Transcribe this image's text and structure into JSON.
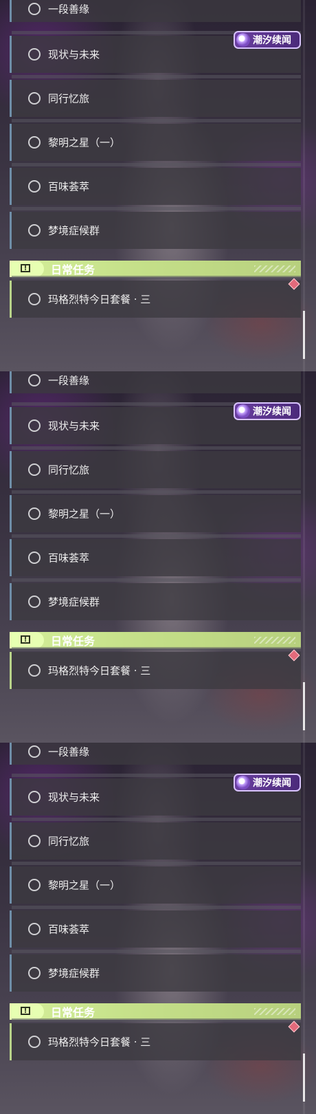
{
  "panels": [
    {
      "event_badge": "潮汐续闻",
      "quests": [
        "一段善缘",
        "现状与未来",
        "同行忆旅",
        "黎明之星（一）",
        "百味荟萃",
        "梦境症候群"
      ],
      "daily_section": {
        "title": "日常任务",
        "quest": "玛格烈特今日套餐 · 三"
      }
    },
    {
      "event_badge": "潮汐续闻",
      "quests": [
        "一段善缘",
        "现状与未来",
        "同行忆旅",
        "黎明之星（一）",
        "百味荟萃",
        "梦境症候群"
      ],
      "daily_section": {
        "title": "日常任务",
        "quest": "玛格烈特今日套餐 · 三"
      }
    },
    {
      "event_badge": "潮汐续闻",
      "quests": [
        "一段善缘",
        "现状与未来",
        "同行忆旅",
        "黎明之星（一）",
        "百味荟萃",
        "梦境症候群"
      ],
      "daily_section": {
        "title": "日常任务",
        "quest": "玛格烈特今日套餐 · 三"
      }
    }
  ],
  "icons": {
    "quest_status": "circle-icon",
    "daily_header": "exclamation-icon",
    "event_logo": "tide-logo-icon",
    "alert": "diamond-alert-icon"
  },
  "colors": {
    "daily_header": "#c6e18a",
    "quest_border": "#6f8ea8",
    "event_badge": "#6a3fa0",
    "alert": "#e36a7b"
  }
}
